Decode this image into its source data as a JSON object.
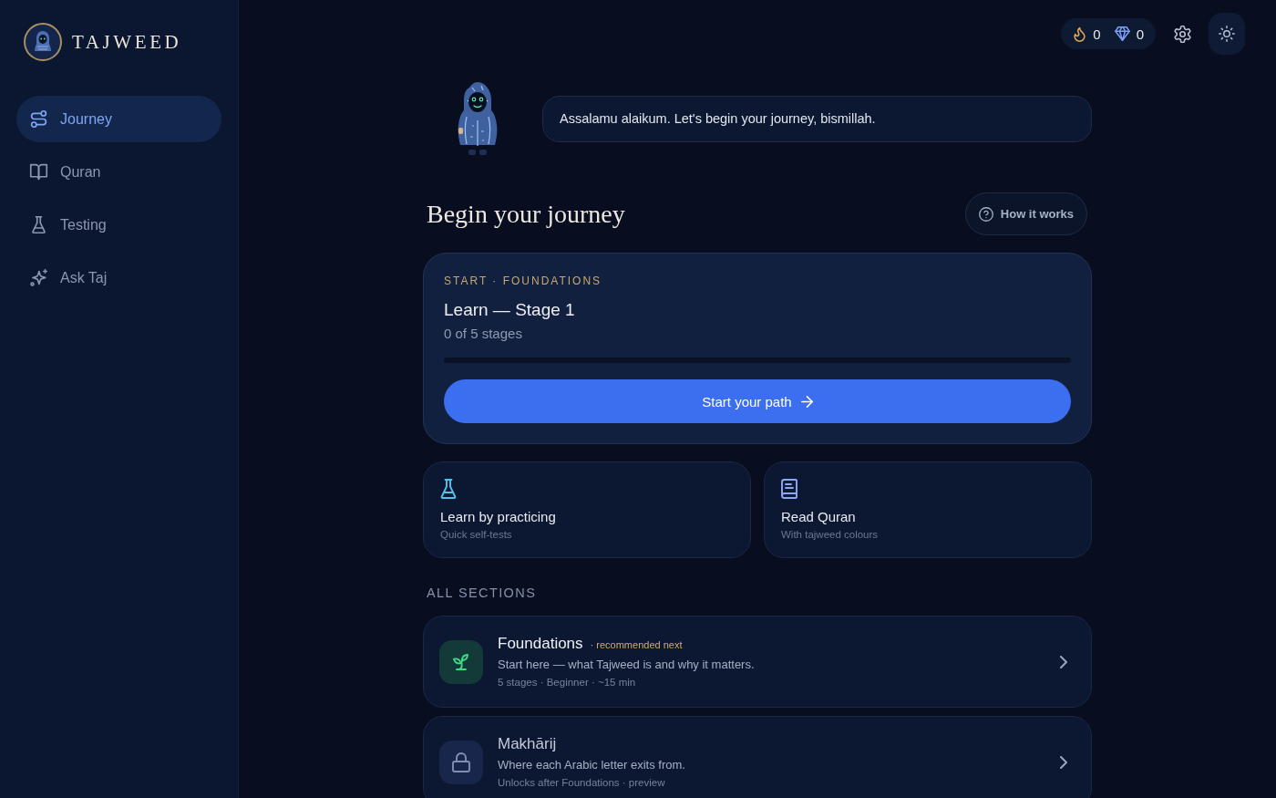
{
  "sidebar": {
    "brand": "TAJWEED",
    "items": [
      {
        "label": "Journey",
        "kind": "route",
        "selected": true
      },
      {
        "label": "Quran",
        "kind": "book",
        "selected": false
      },
      {
        "label": "Testing",
        "kind": "flask",
        "selected": false
      },
      {
        "label": "Ask Taj",
        "kind": "sparkle",
        "selected": false
      }
    ]
  },
  "top_bar": {
    "streak": "0",
    "gems": "0"
  },
  "greeting": {
    "message": "Assalamu alaikum. Let's begin your journey, bismillah."
  },
  "heading": {
    "title": "Begin your journey",
    "help_button": "How it works"
  },
  "current_path": {
    "eyebrow": "START · FOUNDATIONS",
    "title": "Learn — Stage 1",
    "progress_text": "0 of 5 stages",
    "button": "Start your path"
  },
  "quick_actions": [
    {
      "kind": "flask",
      "title": "Learn by practicing",
      "subtitle": "Quick self-tests"
    },
    {
      "kind": "book-text",
      "title": "Read Quran",
      "subtitle": "With tajweed colours"
    }
  ],
  "sections": {
    "heading": "ALL SECTIONS",
    "items": [
      {
        "title": "Foundations",
        "badge": "· recommended next",
        "description": "Start here — what Tajweed is and why it matters.",
        "meta": "5 stages · Beginner · ~15 min",
        "locked": false
      },
      {
        "title": "Makhārij",
        "description": "Where each Arabic letter exits from.",
        "meta": "Unlocks after Foundations · preview",
        "locked": true
      }
    ]
  }
}
